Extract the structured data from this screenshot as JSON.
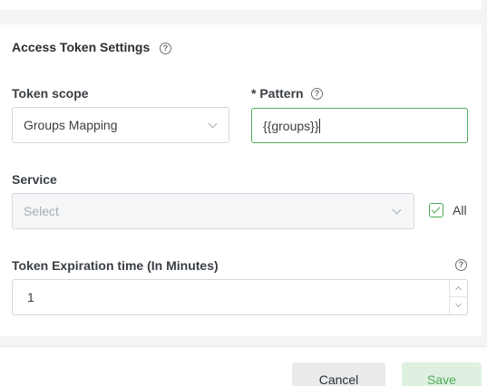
{
  "section": {
    "title": "Access Token Settings"
  },
  "token_scope": {
    "label": "Token scope",
    "value": "Groups Mapping"
  },
  "pattern": {
    "required_marker": "*",
    "label": "Pattern",
    "value": "{{groups}}"
  },
  "service": {
    "label": "Service",
    "placeholder": "Select",
    "all_label": "All",
    "all_checked": true
  },
  "expiration": {
    "label": "Token Expiration time (In Minutes)",
    "value": "1"
  },
  "buttons": {
    "cancel": "Cancel",
    "save": "Save"
  },
  "colors": {
    "accent": "#4caa57",
    "accent_bg": "#dff0e0"
  }
}
